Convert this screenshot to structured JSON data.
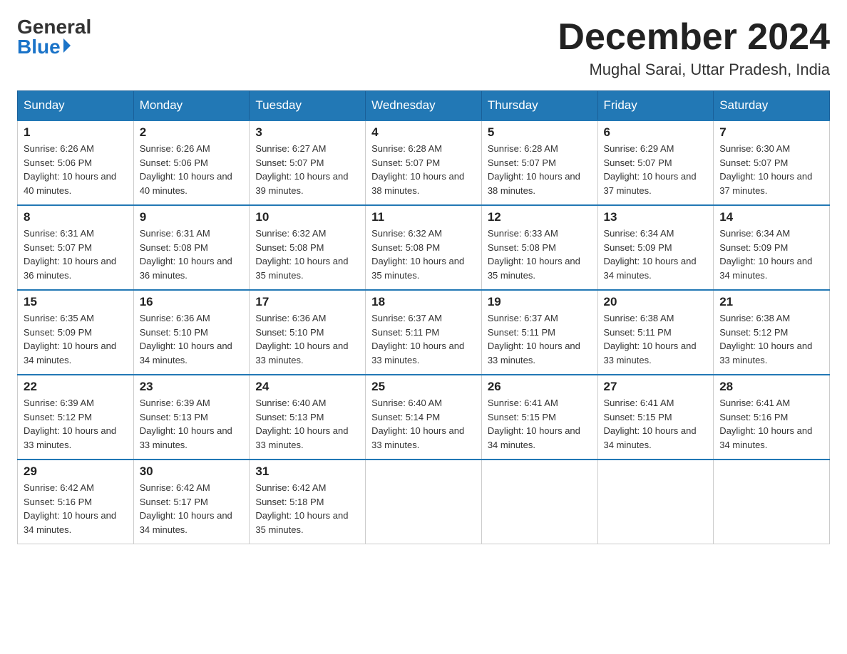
{
  "header": {
    "logo_general": "General",
    "logo_blue": "Blue",
    "month_title": "December 2024",
    "location": "Mughal Sarai, Uttar Pradesh, India"
  },
  "days_of_week": [
    "Sunday",
    "Monday",
    "Tuesday",
    "Wednesday",
    "Thursday",
    "Friday",
    "Saturday"
  ],
  "weeks": [
    [
      {
        "day": "1",
        "sunrise": "6:26 AM",
        "sunset": "5:06 PM",
        "daylight": "10 hours and 40 minutes."
      },
      {
        "day": "2",
        "sunrise": "6:26 AM",
        "sunset": "5:06 PM",
        "daylight": "10 hours and 40 minutes."
      },
      {
        "day": "3",
        "sunrise": "6:27 AM",
        "sunset": "5:07 PM",
        "daylight": "10 hours and 39 minutes."
      },
      {
        "day": "4",
        "sunrise": "6:28 AM",
        "sunset": "5:07 PM",
        "daylight": "10 hours and 38 minutes."
      },
      {
        "day": "5",
        "sunrise": "6:28 AM",
        "sunset": "5:07 PM",
        "daylight": "10 hours and 38 minutes."
      },
      {
        "day": "6",
        "sunrise": "6:29 AM",
        "sunset": "5:07 PM",
        "daylight": "10 hours and 37 minutes."
      },
      {
        "day": "7",
        "sunrise": "6:30 AM",
        "sunset": "5:07 PM",
        "daylight": "10 hours and 37 minutes."
      }
    ],
    [
      {
        "day": "8",
        "sunrise": "6:31 AM",
        "sunset": "5:07 PM",
        "daylight": "10 hours and 36 minutes."
      },
      {
        "day": "9",
        "sunrise": "6:31 AM",
        "sunset": "5:08 PM",
        "daylight": "10 hours and 36 minutes."
      },
      {
        "day": "10",
        "sunrise": "6:32 AM",
        "sunset": "5:08 PM",
        "daylight": "10 hours and 35 minutes."
      },
      {
        "day": "11",
        "sunrise": "6:32 AM",
        "sunset": "5:08 PM",
        "daylight": "10 hours and 35 minutes."
      },
      {
        "day": "12",
        "sunrise": "6:33 AM",
        "sunset": "5:08 PM",
        "daylight": "10 hours and 35 minutes."
      },
      {
        "day": "13",
        "sunrise": "6:34 AM",
        "sunset": "5:09 PM",
        "daylight": "10 hours and 34 minutes."
      },
      {
        "day": "14",
        "sunrise": "6:34 AM",
        "sunset": "5:09 PM",
        "daylight": "10 hours and 34 minutes."
      }
    ],
    [
      {
        "day": "15",
        "sunrise": "6:35 AM",
        "sunset": "5:09 PM",
        "daylight": "10 hours and 34 minutes."
      },
      {
        "day": "16",
        "sunrise": "6:36 AM",
        "sunset": "5:10 PM",
        "daylight": "10 hours and 34 minutes."
      },
      {
        "day": "17",
        "sunrise": "6:36 AM",
        "sunset": "5:10 PM",
        "daylight": "10 hours and 33 minutes."
      },
      {
        "day": "18",
        "sunrise": "6:37 AM",
        "sunset": "5:11 PM",
        "daylight": "10 hours and 33 minutes."
      },
      {
        "day": "19",
        "sunrise": "6:37 AM",
        "sunset": "5:11 PM",
        "daylight": "10 hours and 33 minutes."
      },
      {
        "day": "20",
        "sunrise": "6:38 AM",
        "sunset": "5:11 PM",
        "daylight": "10 hours and 33 minutes."
      },
      {
        "day": "21",
        "sunrise": "6:38 AM",
        "sunset": "5:12 PM",
        "daylight": "10 hours and 33 minutes."
      }
    ],
    [
      {
        "day": "22",
        "sunrise": "6:39 AM",
        "sunset": "5:12 PM",
        "daylight": "10 hours and 33 minutes."
      },
      {
        "day": "23",
        "sunrise": "6:39 AM",
        "sunset": "5:13 PM",
        "daylight": "10 hours and 33 minutes."
      },
      {
        "day": "24",
        "sunrise": "6:40 AM",
        "sunset": "5:13 PM",
        "daylight": "10 hours and 33 minutes."
      },
      {
        "day": "25",
        "sunrise": "6:40 AM",
        "sunset": "5:14 PM",
        "daylight": "10 hours and 33 minutes."
      },
      {
        "day": "26",
        "sunrise": "6:41 AM",
        "sunset": "5:15 PM",
        "daylight": "10 hours and 34 minutes."
      },
      {
        "day": "27",
        "sunrise": "6:41 AM",
        "sunset": "5:15 PM",
        "daylight": "10 hours and 34 minutes."
      },
      {
        "day": "28",
        "sunrise": "6:41 AM",
        "sunset": "5:16 PM",
        "daylight": "10 hours and 34 minutes."
      }
    ],
    [
      {
        "day": "29",
        "sunrise": "6:42 AM",
        "sunset": "5:16 PM",
        "daylight": "10 hours and 34 minutes."
      },
      {
        "day": "30",
        "sunrise": "6:42 AM",
        "sunset": "5:17 PM",
        "daylight": "10 hours and 34 minutes."
      },
      {
        "day": "31",
        "sunrise": "6:42 AM",
        "sunset": "5:18 PM",
        "daylight": "10 hours and 35 minutes."
      },
      null,
      null,
      null,
      null
    ]
  ]
}
